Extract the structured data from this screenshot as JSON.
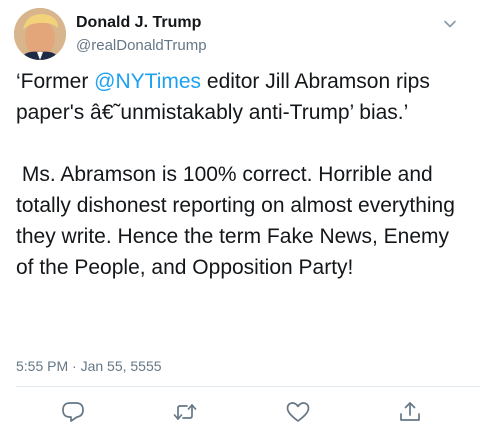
{
  "tweet": {
    "author_name": "Donald J. Trump",
    "author_handle": "@realDonaldTrump",
    "text_before_mention": "‘Former ",
    "mention": "@NYTimes",
    "text_after_mention": " editor Jill Abramson rips paper's â€˜unmistakably anti-Trump’ bias.’\n\n Ms. Abramson is 100% correct. Horrible and totally dishonest reporting on almost everything they write. Hence the term Fake News, Enemy of the People, and Opposition Party!",
    "timestamp": "5:55 PM · Jan 55, 5555"
  },
  "icons": {
    "caret": "chevron-down-icon",
    "reply": "reply-icon",
    "retweet": "retweet-icon",
    "like": "heart-icon",
    "share": "share-icon"
  },
  "colors": {
    "link": "#1da1f2",
    "secondary_text": "#657786",
    "icon": "#657786",
    "divider": "#e1e8ed"
  }
}
